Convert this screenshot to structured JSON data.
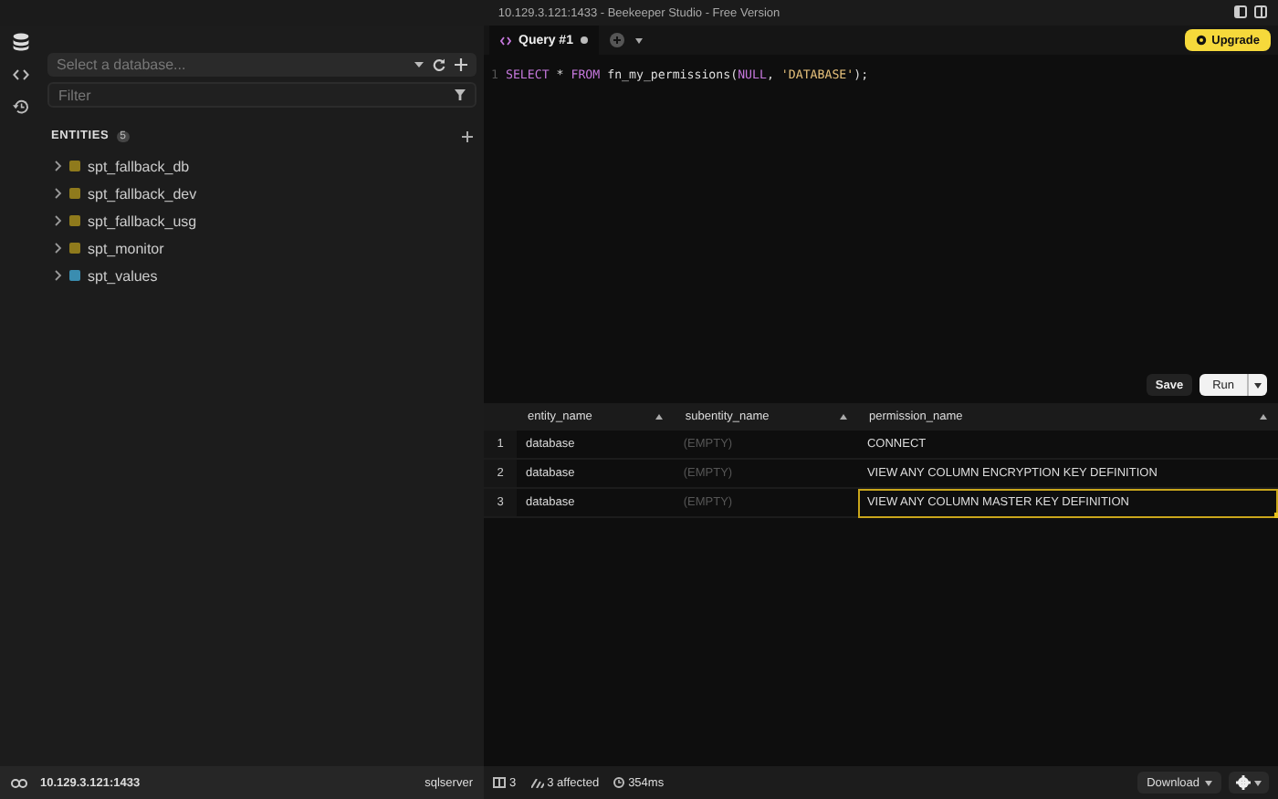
{
  "window": {
    "title": "10.129.3.121:1433 - Beekeeper Studio - Free Version"
  },
  "sidebar": {
    "database_select": {
      "placeholder": "Select a database..."
    },
    "filter": {
      "placeholder": "Filter"
    },
    "section_title": "ENTITIES",
    "count": "5",
    "items": [
      {
        "label": "spt_fallback_db",
        "color": "#8f7a1c"
      },
      {
        "label": "spt_fallback_dev",
        "color": "#8f7a1c"
      },
      {
        "label": "spt_fallback_usg",
        "color": "#8f7a1c"
      },
      {
        "label": "spt_monitor",
        "color": "#8f7a1c"
      },
      {
        "label": "spt_values",
        "color": "#3a8db0"
      }
    ]
  },
  "tabs": [
    {
      "label": "Query #1",
      "selected": true
    }
  ],
  "upgrade_button": "Upgrade",
  "editor": {
    "line_number": "1",
    "tokens": [
      {
        "text": "SELECT",
        "kind": "keyword"
      },
      {
        "text": " * ",
        "kind": "plain"
      },
      {
        "text": "FROM",
        "kind": "keyword"
      },
      {
        "text": " fn_my_permissions(",
        "kind": "plain"
      },
      {
        "text": "NULL",
        "kind": "keyword"
      },
      {
        "text": ", ",
        "kind": "plain"
      },
      {
        "text": "'DATABASE'",
        "kind": "string"
      },
      {
        "text": ");",
        "kind": "plain"
      }
    ]
  },
  "actions": {
    "save": "Save",
    "run": "Run"
  },
  "table": {
    "columns": [
      "entity_name",
      "subentity_name",
      "permission_name"
    ],
    "rows": [
      {
        "number": "1",
        "cells": [
          {
            "text": "database",
            "selected": false
          },
          {
            "text": "(EMPTY)",
            "selected": false
          },
          {
            "text": "CONNECT",
            "selected": false
          }
        ]
      },
      {
        "number": "2",
        "cells": [
          {
            "text": "database",
            "selected": false
          },
          {
            "text": "(EMPTY)",
            "selected": false
          },
          {
            "text": "VIEW ANY COLUMN ENCRYPTION KEY DEFINITION",
            "selected": false
          }
        ]
      },
      {
        "number": "3",
        "cells": [
          {
            "text": "database",
            "selected": false
          },
          {
            "text": "(EMPTY)",
            "selected": false
          },
          {
            "text": "VIEW ANY COLUMN MASTER KEY DEFINITION",
            "selected": true
          }
        ]
      }
    ]
  },
  "status_bar": {
    "connection": "10.129.3.121:1433",
    "dialect": "sqlserver",
    "rows": "3",
    "affected": "3 affected",
    "duration": "354ms",
    "download": "Download"
  }
}
